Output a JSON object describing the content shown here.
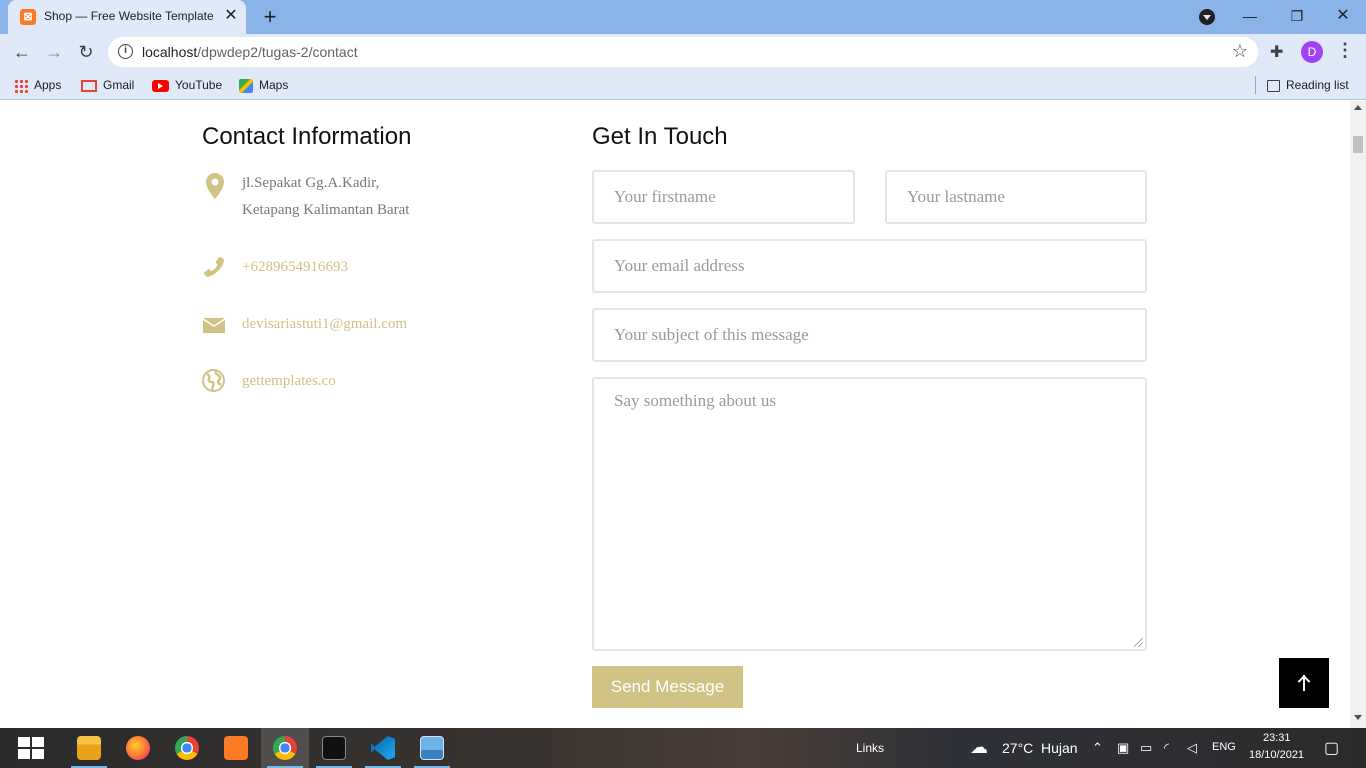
{
  "browser": {
    "tab_title": "Shop — Free Website Template, F",
    "url_host": "localhost",
    "url_path": "/dpwdep2/tugas-2/contact",
    "profile_initial": "D",
    "bookmarks": [
      {
        "label": "Apps",
        "icon": "apps-icon"
      },
      {
        "label": "Gmail",
        "icon": "gmail-icon"
      },
      {
        "label": "YouTube",
        "icon": "youtube-icon"
      },
      {
        "label": "Maps",
        "icon": "maps-icon"
      }
    ],
    "reading_list": "Reading list"
  },
  "page": {
    "contact_info_heading": "Contact Information",
    "get_in_touch_heading": "Get In Touch",
    "contact_items": [
      {
        "icon": "map-pin-icon",
        "line1": "jl.Sepakat Gg.A.Kadir,",
        "line2": "Ketapang Kalimantan Barat"
      },
      {
        "icon": "phone-icon",
        "text": "+6289654916693"
      },
      {
        "icon": "mail-icon",
        "text": "devisariastuti1@gmail.com"
      },
      {
        "icon": "globe-icon",
        "text": "gettemplates.co"
      }
    ],
    "form": {
      "firstname_placeholder": "Your firstname",
      "lastname_placeholder": "Your lastname",
      "email_placeholder": "Your email address",
      "subject_placeholder": "Your subject of this message",
      "message_placeholder": "Say something about us",
      "submit_label": "Send Message"
    },
    "accent_color": "#d1c286"
  },
  "taskbar": {
    "links_label": "Links",
    "weather_temp": "27°C",
    "weather_desc": "Hujan",
    "language": "ENG",
    "time": "23:31",
    "date": "18/10/2021",
    "apps": [
      "start-icon",
      "file-explorer-icon",
      "firefox-icon",
      "chrome-icon",
      "xampp-icon",
      "chrome-profile-icon",
      "terminal-icon",
      "vscode-icon",
      "image-viewer-icon"
    ]
  }
}
